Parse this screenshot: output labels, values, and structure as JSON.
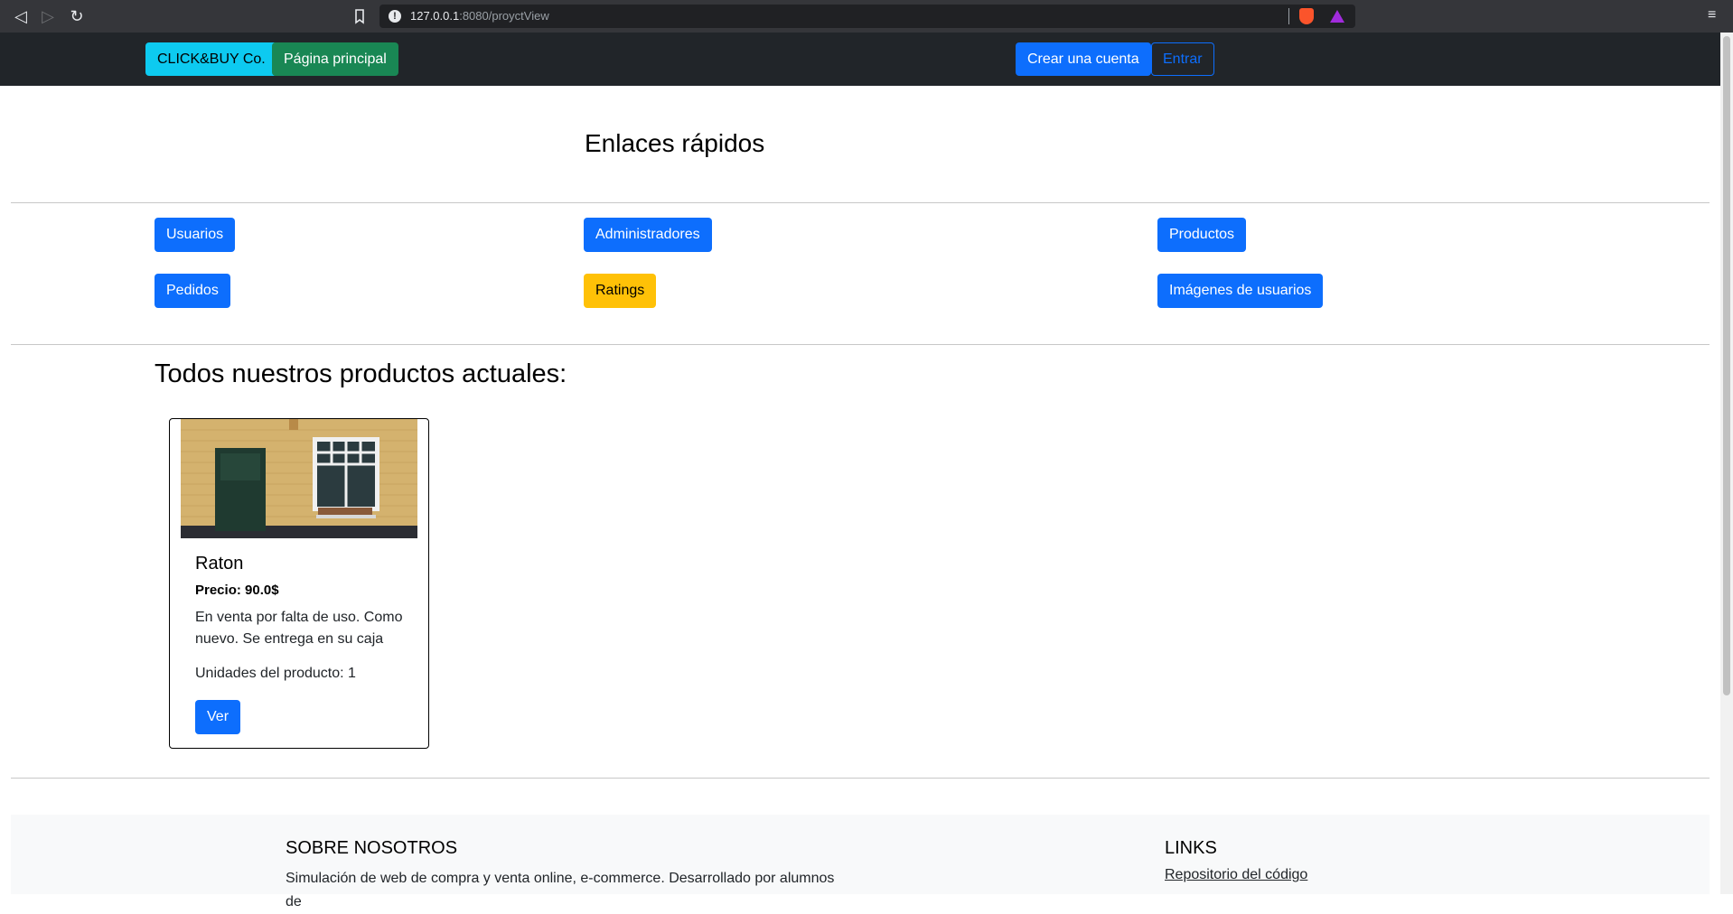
{
  "browser": {
    "url_host": "127.0.0.1",
    "url_rest": ":8080/proуctView"
  },
  "navbar": {
    "brand_label": "CLICK&BUY Co.",
    "home_label": "Página principal",
    "signup_label": "Crear una cuenta",
    "login_label": "Entrar"
  },
  "quick_links": {
    "title": "Enlaces rápidos",
    "users": "Usuarios",
    "admins": "Administradores",
    "products": "Productos",
    "orders": "Pedidos",
    "ratings": "Ratings",
    "user_images": "Imágenes de usuarios"
  },
  "products_section": {
    "title": "Todos nuestros productos actuales:",
    "items": [
      {
        "name": "Raton",
        "price": "Precio: 90.0$",
        "description": "En venta por falta de uso. Como nuevo. Se entrega en su caja",
        "units": "Unidades del producto: 1",
        "view_label": "Ver"
      }
    ]
  },
  "footer": {
    "about_title": "SOBRE NOSOTROS",
    "about_text": "Simulación de web de compra y venta online, e-commerce. Desarrollado por alumnos de",
    "links_title": "LINKS",
    "repo_link": "Repositorio del código"
  },
  "colors": {
    "primary": "#0d6efd",
    "info": "#0dcaf0",
    "success": "#198754",
    "warning": "#ffc107",
    "navbar_bg": "#212529"
  }
}
